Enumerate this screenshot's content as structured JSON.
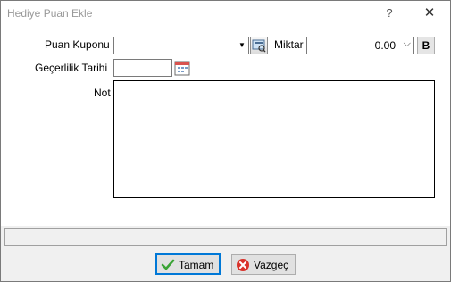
{
  "window": {
    "title": "Hediye Puan Ekle",
    "help_glyph": "?",
    "close_glyph": "✕"
  },
  "form": {
    "coupon_label": "Puan Kuponu",
    "coupon_value": "",
    "amount_label": "Miktar",
    "amount_value": "0.00",
    "b_label": "B",
    "validity_label": "Geçerlilik Tarihi",
    "validity_value": "",
    "note_label": "Not",
    "note_value": ""
  },
  "status": {
    "text": ""
  },
  "buttons": {
    "ok_first": "T",
    "ok_rest": "amam",
    "cancel_first": "V",
    "cancel_rest": "azgeç"
  },
  "icons": {
    "coupon_browse": "browse-icon",
    "calendar": "calendar-icon",
    "ok": "checkmark-icon",
    "cancel": "cancel-x-icon"
  },
  "colors": {
    "default_border": "#0078d7",
    "ok_green": "#3aa335",
    "cancel_red": "#d9322b"
  }
}
